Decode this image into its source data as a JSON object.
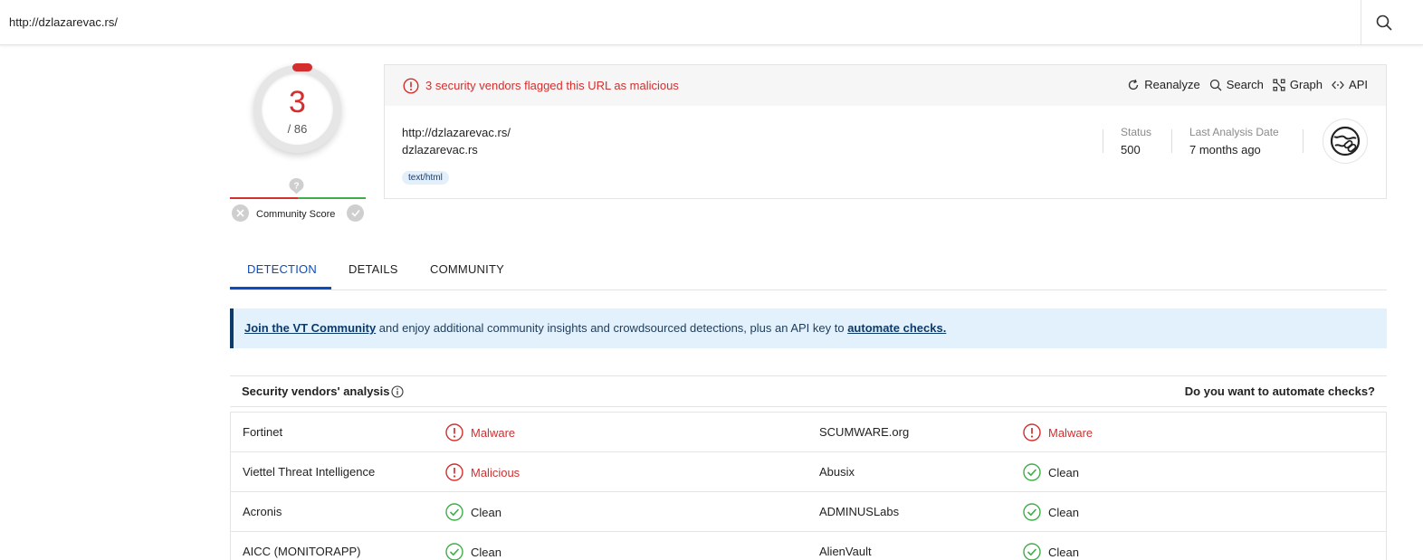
{
  "search": {
    "value": "http://dzlazarevac.rs/"
  },
  "score": {
    "detections": "3",
    "total": "/ 86"
  },
  "community": {
    "label": "Community Score"
  },
  "alert": {
    "text": "3 security vendors flagged this URL as malicious"
  },
  "actions": [
    {
      "label": "Reanalyze",
      "icon": "refresh-icon"
    },
    {
      "label": "Search",
      "icon": "search-icon"
    },
    {
      "label": "Graph",
      "icon": "graph-icon"
    },
    {
      "label": "API",
      "icon": "api-icon"
    }
  ],
  "summary": {
    "url": "http://dzlazarevac.rs/",
    "domain": "dzlazarevac.rs",
    "tag": "text/html",
    "status_label": "Status",
    "status_value": "500",
    "date_label": "Last Analysis Date",
    "date_value": "7 months ago"
  },
  "tabs": [
    "DETECTION",
    "DETAILS",
    "COMMUNITY"
  ],
  "banner": {
    "link1": "Join the VT Community",
    "middle": " and enjoy additional community insights and crowdsourced detections, plus an API key to ",
    "link2": "automate checks."
  },
  "vendors_header": {
    "title": "Security vendors' analysis",
    "right": "Do you want to automate checks?"
  },
  "vendors": [
    {
      "left_name": "Fortinet",
      "left_result": "Malware",
      "left_status": "malicious",
      "right_name": "SCUMWARE.org",
      "right_result": "Malware",
      "right_status": "malicious"
    },
    {
      "left_name": "Viettel Threat Intelligence",
      "left_result": "Malicious",
      "left_status": "malicious",
      "right_name": "Abusix",
      "right_result": "Clean",
      "right_status": "clean"
    },
    {
      "left_name": "Acronis",
      "left_result": "Clean",
      "left_status": "clean",
      "right_name": "ADMINUSLabs",
      "right_result": "Clean",
      "right_status": "clean"
    },
    {
      "left_name": "AICC (MONITORAPP)",
      "left_result": "Clean",
      "left_status": "clean",
      "right_name": "AlienVault",
      "right_result": "Clean",
      "right_status": "clean"
    }
  ],
  "colors": {
    "malicious": "#d32f2f",
    "clean": "#3fae49",
    "accent": "#0b4dbf"
  }
}
